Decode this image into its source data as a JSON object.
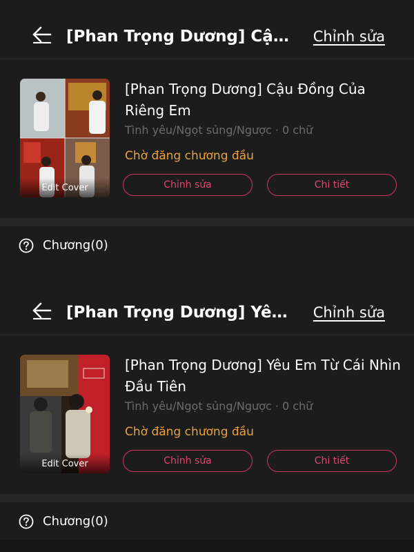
{
  "stories": [
    {
      "header": {
        "title": "[Phan Trọng Dương] Cậu...",
        "edit_label": "Chỉnh sửa"
      },
      "card": {
        "cover_caption": "Edit Cover",
        "title": "[Phan Trọng Dương] Cậu Đồng Của Riêng Em",
        "meta": "Tình yêu/Ngọt sủng/Ngược · 0 chữ",
        "status": "Chờ đăng chương đầu",
        "edit_button": "Chỉnh sửa",
        "detail_button": "Chi tiết"
      },
      "chapters_label": "Chương(0)"
    },
    {
      "header": {
        "title": "[Phan Trọng Dương] Yêu...",
        "edit_label": "Chỉnh sửa"
      },
      "card": {
        "cover_caption": "Edit Cover",
        "title": "[Phan Trọng Dương] Yêu Em Từ Cái Nhìn Đầu Tiên",
        "meta": "Tình yêu/Ngọt sủng/Ngược · 0 chữ",
        "status": "Chờ đăng chương đầu",
        "edit_button": "Chỉnh sửa",
        "detail_button": "Chi tiết"
      },
      "chapters_label": "Chương(0)"
    }
  ],
  "icons": {
    "back": "arrow-left-icon",
    "help": "question-circle-icon"
  },
  "colors": {
    "accent": "#e0466f",
    "status": "#e8a33a",
    "meta": "#6c6c6c",
    "background": "#1c1c1d"
  }
}
